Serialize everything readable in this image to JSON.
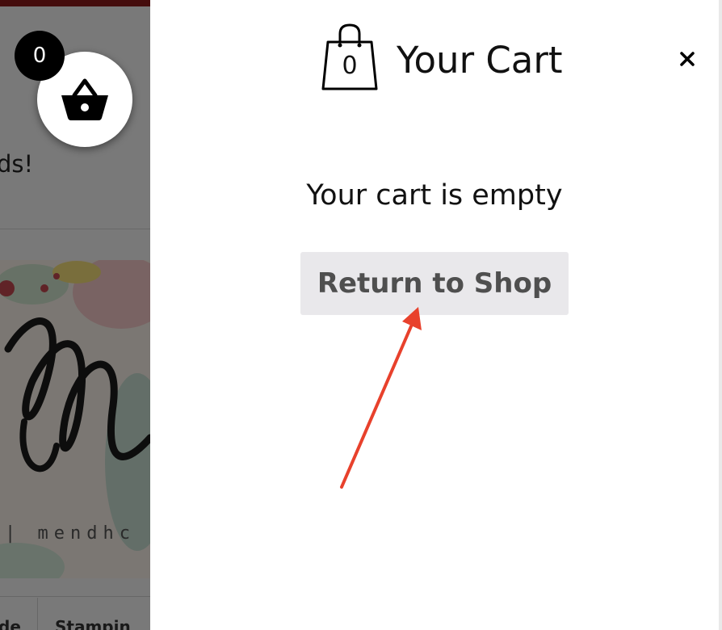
{
  "background_page": {
    "tagline_fragment": "ds!",
    "brand_fragment": "| mendhc",
    "nav_fragments": [
      "de",
      "Stampin"
    ]
  },
  "floating_cart": {
    "count": "0",
    "icon": "basket-icon"
  },
  "cart_drawer": {
    "bag_icon": "shopping-bag-icon",
    "bag_count": "0",
    "title": "Your Cart",
    "close_icon": "close-icon",
    "empty_message": "Your cart is empty",
    "return_button_label": "Return to Shop"
  },
  "annotation": {
    "arrow_color": "#e8412c"
  },
  "colors": {
    "overlay": "rgba(0,0,0,0.5)",
    "button_bg": "#e9e8eb",
    "button_text": "#4f4f4f",
    "top_bar": "#8a1b1b"
  }
}
